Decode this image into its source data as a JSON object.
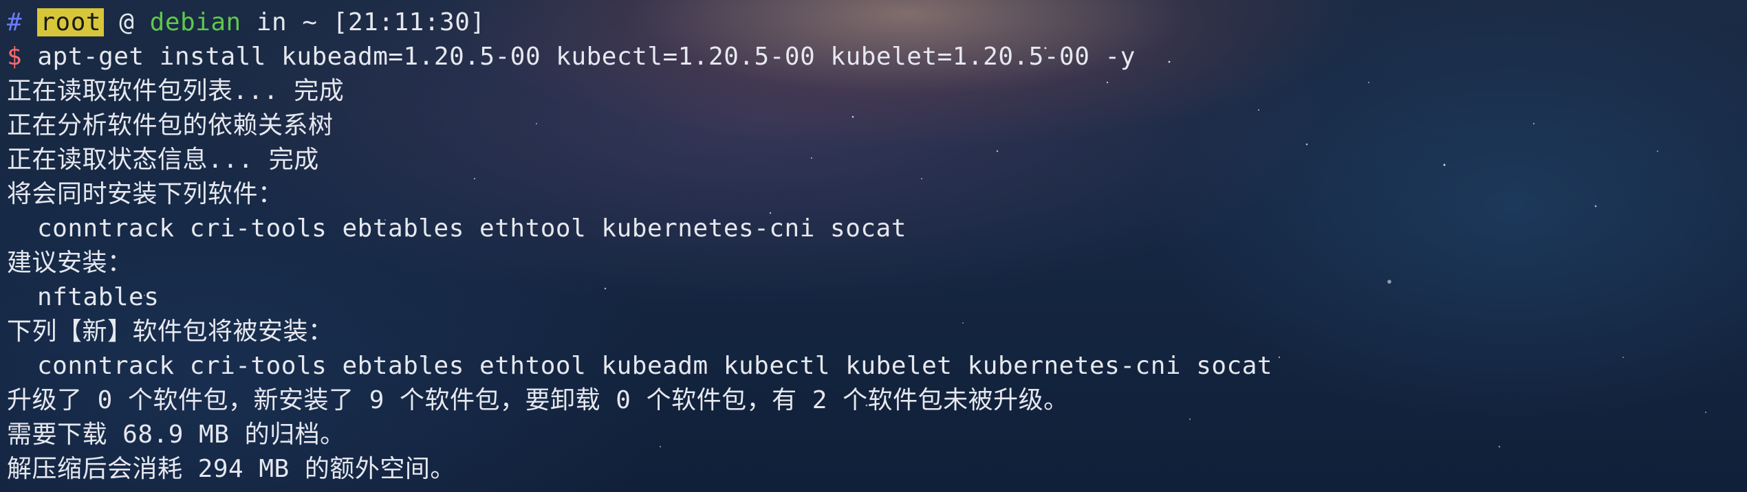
{
  "terminal": {
    "prompt_line": {
      "hash": "#",
      "user": "root",
      "at": "@",
      "host": "debian",
      "in": "in",
      "path": "~",
      "time": "[21:11:30]"
    },
    "command": {
      "symbol": "$",
      "text": "apt-get install kubeadm=1.20.5-00 kubectl=1.20.5-00 kubelet=1.20.5-00 -y"
    },
    "output": [
      "正在读取软件包列表... 完成",
      "正在分析软件包的依赖关系树",
      "正在读取状态信息... 完成",
      "将会同时安装下列软件：",
      "conntrack cri-tools ebtables ethtool kubernetes-cni socat",
      "建议安装：",
      "nftables",
      "下列【新】软件包将被安装：",
      "conntrack cri-tools ebtables ethtool kubeadm kubectl kubelet kubernetes-cni socat",
      "升级了 0 个软件包，新安装了 9 个软件包，要卸载 0 个软件包，有 2 个软件包未被升级。",
      "需要下载 68.9 MB 的归档。",
      "解压缩后会消耗 294 MB 的额外空间。"
    ]
  },
  "colors": {
    "hash": "#6b7cff",
    "user_bg": "#d7c63a",
    "host": "#5ec84b",
    "prompt_symbol": "#ff6b6b",
    "text": "#e6e8ef"
  }
}
